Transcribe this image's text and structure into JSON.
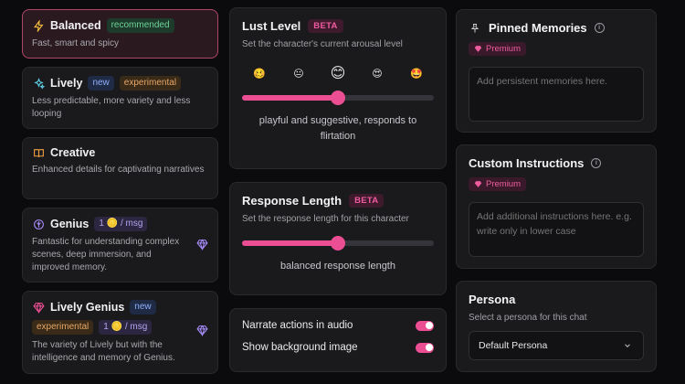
{
  "models": [
    {
      "name": "Balanced",
      "tags": [
        "recommended"
      ],
      "desc": "Fast, smart and spicy",
      "icon": "lightning-icon"
    },
    {
      "name": "Lively",
      "tags": [
        "new",
        "experimental"
      ],
      "desc": "Less predictable, more variety and less looping",
      "icon": "sparkles-icon"
    },
    {
      "name": "Creative",
      "tags": [],
      "desc": "Enhanced details for captivating narratives",
      "icon": "book-icon"
    },
    {
      "name": "Genius",
      "tags": [
        "1 🪙 / msg"
      ],
      "desc": "Fantastic for understanding complex scenes, deep immersion, and improved memory.",
      "icon": "brain-icon"
    },
    {
      "name": "Lively Genius",
      "tags": [
        "new",
        "experimental",
        "1 🪙 / msg"
      ],
      "desc": "The variety of Lively but with the intelligence and memory of Genius.",
      "icon": "gem-icon"
    }
  ],
  "lust": {
    "title": "Lust Level",
    "badge": "BETA",
    "subtitle": "Set the character's current arousal level",
    "emojis": [
      "🥴",
      "😐",
      "😊",
      "😍",
      "🤩"
    ],
    "caption": "playful and suggestive, responds to flirtation",
    "level": 0.5
  },
  "response": {
    "title": "Response Length",
    "badge": "BETA",
    "subtitle": "Set the response length for this character",
    "caption": "balanced response length",
    "level": 0.5
  },
  "toggles": {
    "narrate_label": "Narrate actions in audio",
    "background_label": "Show background image"
  },
  "pinned": {
    "title": "Pinned Memories",
    "premium": "Premium",
    "placeholder": "Add persistent memories here."
  },
  "custom": {
    "title": "Custom Instructions",
    "premium": "Premium",
    "placeholder": "Add additional instructions here. e.g. write only in lower case"
  },
  "persona": {
    "title": "Persona",
    "subtitle": "Select a persona for this chat",
    "selected": "Default Persona"
  },
  "colors": {
    "accent": "#ec4e93",
    "selected_border": "#b0456a"
  }
}
